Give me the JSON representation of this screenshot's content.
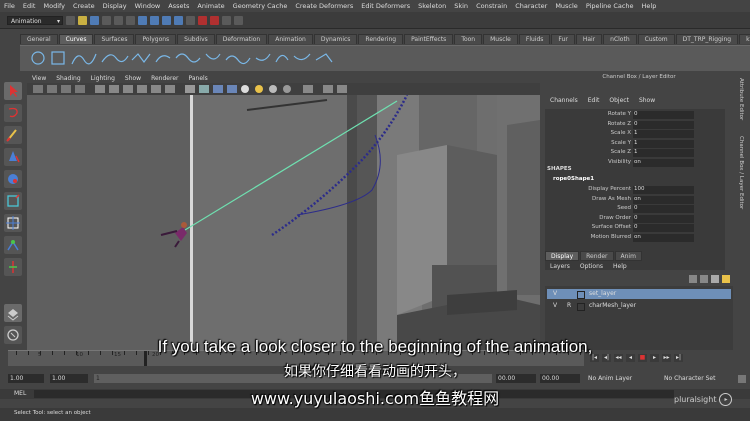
{
  "menubar": [
    "File",
    "Edit",
    "Modify",
    "Create",
    "Display",
    "Window",
    "Assets",
    "Animate",
    "Geometry Cache",
    "Create Deformers",
    "Edit Deformers",
    "Skeleton",
    "Skin",
    "Constrain",
    "Character",
    "Muscle",
    "Pipeline Cache",
    "Help"
  ],
  "mode": "Animation",
  "shelf_tabs": [
    "General",
    "Curves",
    "Surfaces",
    "Polygons",
    "Subdivs",
    "Deformation",
    "Animation",
    "Dynamics",
    "Rendering",
    "PaintEffects",
    "Toon",
    "Muscle",
    "Fluids",
    "Fur",
    "Hair",
    "nCloth",
    "Custom",
    "DT_TRP_Rigging",
    "kfi_m"
  ],
  "active_shelf_tab": "Curves",
  "panel_menu": [
    "View",
    "Shading",
    "Lighting",
    "Show",
    "Renderer",
    "Panels"
  ],
  "channel_box": {
    "title": "Channel Box / Layer Editor",
    "menu": [
      "Channels",
      "Edit",
      "Object",
      "Show"
    ],
    "attrs": [
      {
        "label": "Rotate Y",
        "value": "0"
      },
      {
        "label": "Rotate Z",
        "value": "0"
      },
      {
        "label": "Scale X",
        "value": "1"
      },
      {
        "label": "Scale Y",
        "value": "1"
      },
      {
        "label": "Scale Z",
        "value": "1"
      },
      {
        "label": "Visibility",
        "value": "on"
      }
    ],
    "shapes_header": "SHAPES",
    "shape_name": "rope0Shape1",
    "shape_attrs": [
      {
        "label": "Display Percent",
        "value": "100"
      },
      {
        "label": "Draw As Mesh",
        "value": "on"
      },
      {
        "label": "Seed",
        "value": "0"
      },
      {
        "label": "Draw Order",
        "value": "0"
      },
      {
        "label": "Surface Offset",
        "value": "0"
      },
      {
        "label": "Motion Blurred",
        "value": "on"
      }
    ]
  },
  "side_tabs": [
    "Attribute Editor",
    "Channel Box / Layer Editor"
  ],
  "layer_editor": {
    "tabs": [
      "Display",
      "Render",
      "Anim"
    ],
    "active_tab": "Display",
    "menu": [
      "Layers",
      "Options",
      "Help"
    ],
    "layers": [
      {
        "v": "V",
        "r": "",
        "name": "set_layer",
        "selected": true
      },
      {
        "v": "V",
        "r": "R",
        "name": "charMesh_layer",
        "selected": false
      }
    ]
  },
  "timeline": {
    "ticks": [
      "5",
      "10",
      "15",
      "20"
    ]
  },
  "range": {
    "start": "1.00",
    "current": "1.00",
    "frame_box": "1",
    "end1": "00.00",
    "end2": "00.00",
    "anim_layer": "No Anim Layer",
    "character_set": "No Character Set"
  },
  "mel_label": "MEL",
  "help_line": "Select Tool: select an object",
  "subtitles": {
    "en": "If you take a look closer to the beginning of the animation,",
    "zh": "如果你仔细看看动画的开头，",
    "url": "www.yuyulaoshi.com鱼鱼教程网"
  },
  "logo": "pluralsight",
  "colors": {
    "selected_layer": "#6e8fb8",
    "viewport": "#6d6d6d",
    "rope": "#3a3a9a",
    "line": "#5fd3a0"
  }
}
